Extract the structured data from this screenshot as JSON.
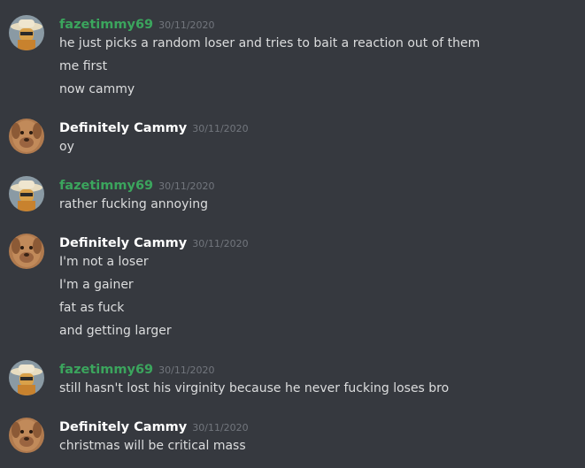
{
  "colors": {
    "background": "#36393f",
    "text": "#dcddde",
    "username_green": "#3ba55d",
    "username_white": "#ffffff",
    "timestamp": "#72767d"
  },
  "messages": [
    {
      "author": "fazetimmy69",
      "avatar": "cowboy-avatar-icon",
      "timestamp": "30/11/2020",
      "lines": [
        "he just picks a random loser and tries to bait a reaction out of them",
        "me first",
        "now cammy"
      ]
    },
    {
      "author": "Definitely Cammy",
      "avatar": "dog-avatar-icon",
      "timestamp": "30/11/2020",
      "lines": [
        "oy"
      ]
    },
    {
      "author": "fazetimmy69",
      "avatar": "cowboy-avatar-icon",
      "timestamp": "30/11/2020",
      "lines": [
        "rather fucking annoying"
      ]
    },
    {
      "author": "Definitely Cammy",
      "avatar": "dog-avatar-icon",
      "timestamp": "30/11/2020",
      "lines": [
        "I'm not a loser",
        "I'm a gainer",
        "fat as fuck",
        "and getting larger"
      ]
    },
    {
      "author": "fazetimmy69",
      "avatar": "cowboy-avatar-icon",
      "timestamp": "30/11/2020",
      "lines": [
        "still hasn't lost his virginity because he never fucking loses bro"
      ]
    },
    {
      "author": "Definitely Cammy",
      "avatar": "dog-avatar-icon",
      "timestamp": "30/11/2020",
      "lines": [
        "christmas will be critical mass"
      ]
    }
  ]
}
